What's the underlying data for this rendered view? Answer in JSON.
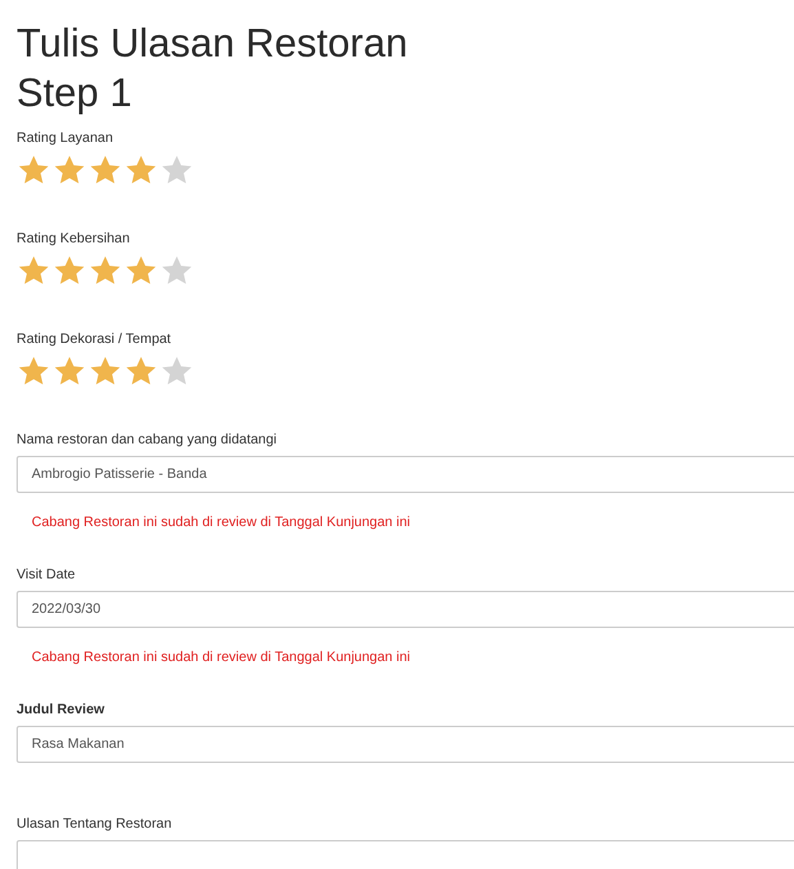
{
  "title": "Tulis Ulasan Restoran",
  "step": "Step 1",
  "ratings": [
    {
      "label": "Rating Layanan",
      "stars": 4
    },
    {
      "label": "Rating Kebersihan",
      "stars": 4
    },
    {
      "label": "Rating Dekorasi / Tempat",
      "stars": 4
    }
  ],
  "fields": [
    {
      "label": "Nama restoran dan cabang yang didatangi",
      "value": "Ambrogio Patisserie - Banda",
      "error": "Cabang Restoran ini sudah di review di Tanggal Kunjungan ini"
    },
    {
      "label": "Visit Date",
      "value": "2022/03/30",
      "error": "Cabang Restoran ini sudah di review di Tanggal Kunjungan ini"
    },
    {
      "label": "Judul Review",
      "value": "Rasa Makanan"
    },
    {
      "label": "Ulasan Tentang Restoran"
    }
  ]
}
